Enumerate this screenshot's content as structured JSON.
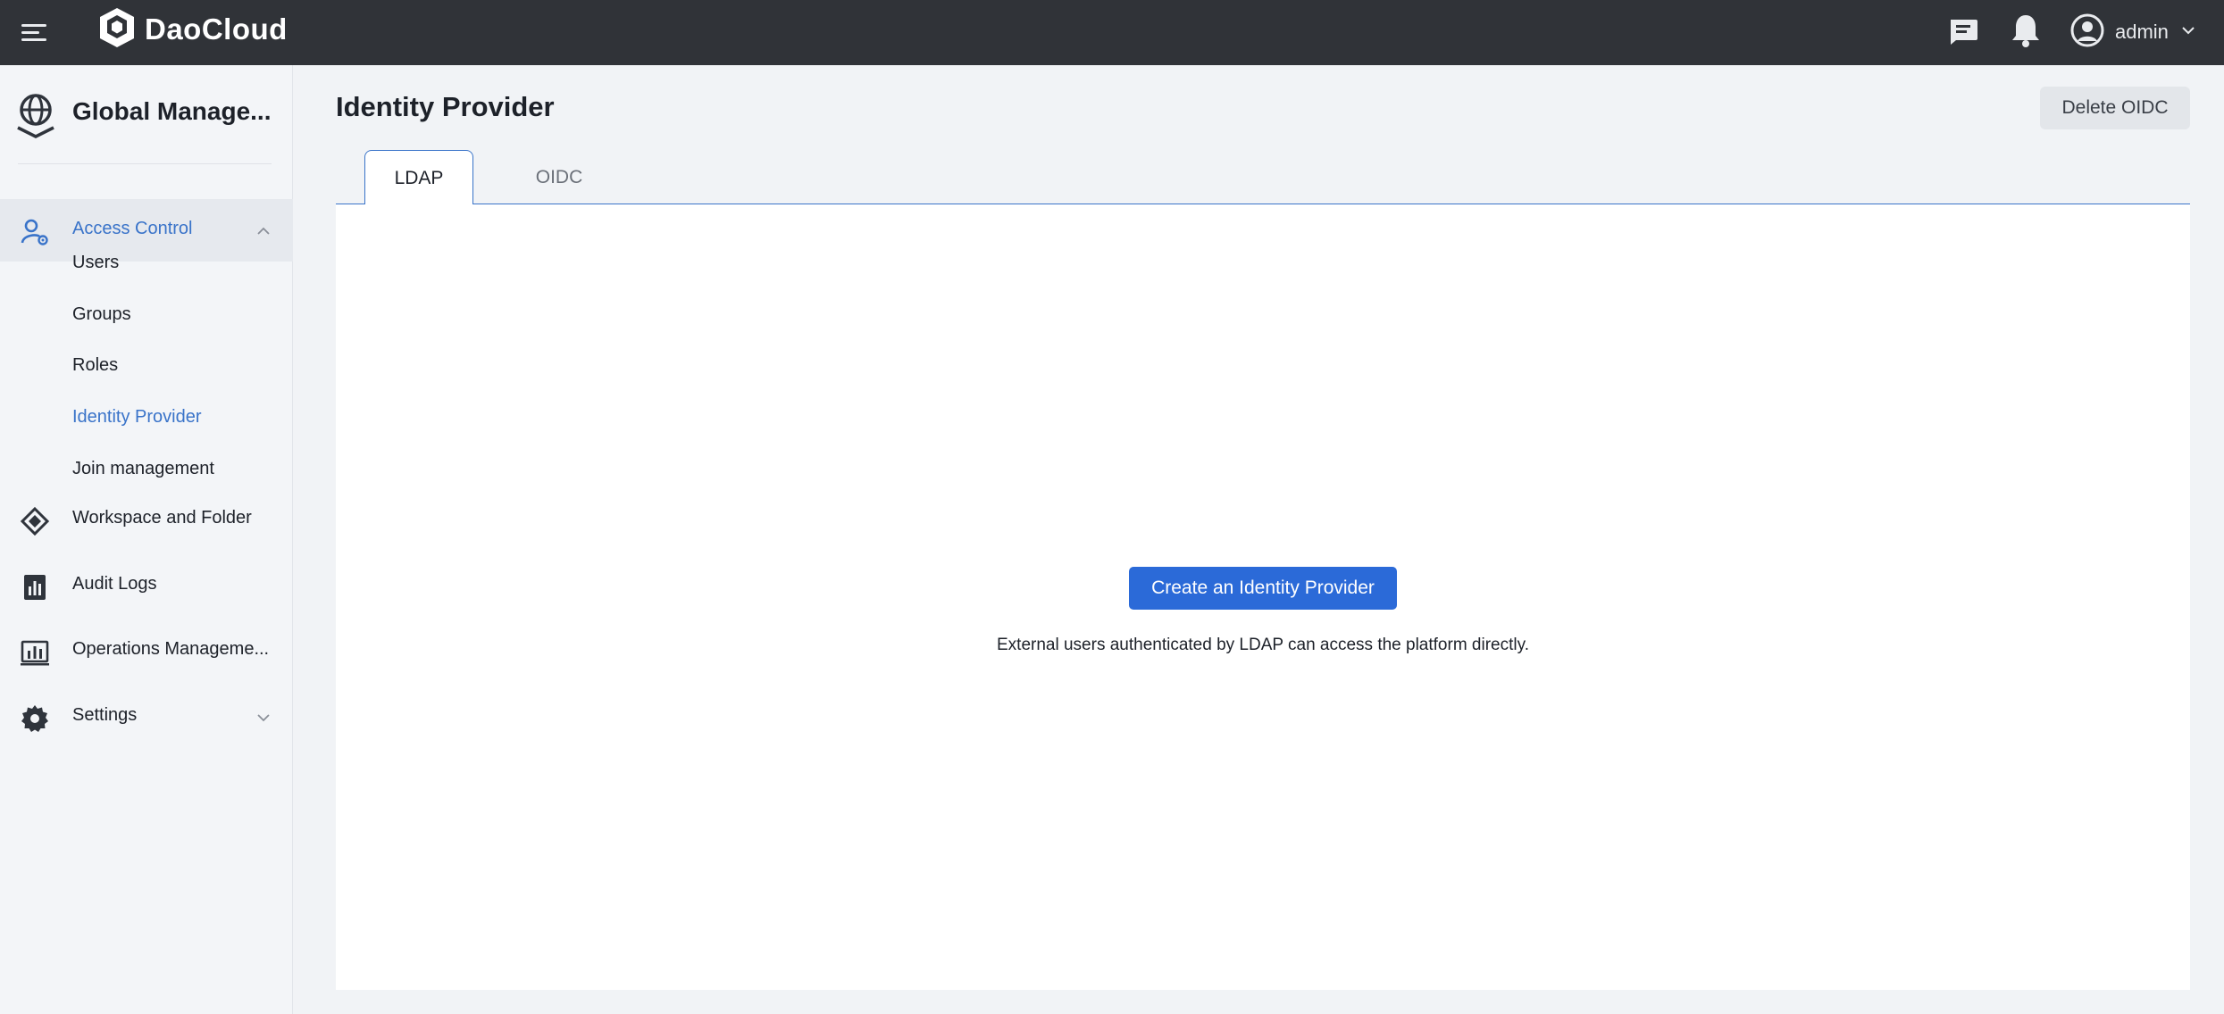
{
  "topbar": {
    "brand": "DaoCloud",
    "user": {
      "name": "admin"
    },
    "icons": [
      "menu-icon",
      "chat-icon",
      "bell-icon",
      "user-avatar-icon",
      "chevron-down-icon"
    ]
  },
  "sidebar": {
    "title": "Global Manage...",
    "groups": [
      {
        "label": "Access Control",
        "icon": "user-gear-icon",
        "expanded": true,
        "items": [
          {
            "label": "Users"
          },
          {
            "label": "Groups"
          },
          {
            "label": "Roles"
          },
          {
            "label": "Identity Provider",
            "active": true
          },
          {
            "label": "Join management"
          }
        ]
      },
      {
        "label": "Workspace and Folder",
        "icon": "workspace-icon"
      },
      {
        "label": "Audit Logs",
        "icon": "audit-log-icon"
      },
      {
        "label": "Operations Manageme...",
        "icon": "operations-chart-icon"
      },
      {
        "label": "Settings",
        "icon": "settings-gear-icon",
        "expanded": false
      }
    ]
  },
  "main": {
    "title": "Identity Provider",
    "delete_label": "Delete OIDC",
    "tabs": [
      {
        "label": "LDAP",
        "active": true
      },
      {
        "label": "OIDC",
        "active": false
      }
    ],
    "empty_state": {
      "button_label": "Create an Identity Provider",
      "description": "External users authenticated by LDAP can access the platform directly."
    }
  },
  "colors": {
    "topbar_bg": "#303338",
    "accent": "#3973c9",
    "primary_button": "#2b6ad8"
  }
}
